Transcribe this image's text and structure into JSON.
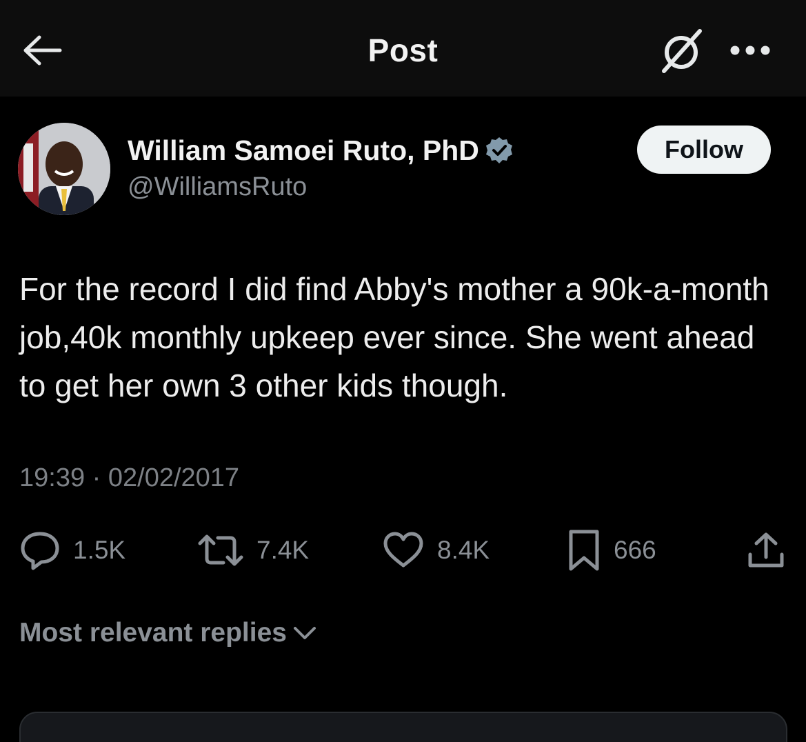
{
  "header": {
    "title": "Post",
    "back_icon": "arrow-left-icon",
    "grok_icon": "grok-slash-icon",
    "more_icon": "more-dots-icon"
  },
  "author": {
    "name": "William Samoei Ruto, PhD",
    "handle": "@WilliamsRuto",
    "verified_icon": "verified-badge-icon",
    "verified_color": "#829aab",
    "follow_label": "Follow"
  },
  "post": {
    "text": "For the record I did find Abby's mother a 90k-a-month job,40k monthly upkeep ever since. She went ahead to get her own 3 other kids though.",
    "timestamp": "19:39 · 02/02/2017"
  },
  "actions": {
    "replies": "1.5K",
    "reposts": "7.4K",
    "likes": "8.4K",
    "bookmarks": "666"
  },
  "replies_sort": {
    "label": "Most relevant replies"
  },
  "colors": {
    "background": "#000000",
    "header_background": "#0d0d0d",
    "text_primary": "#e7e9ea",
    "text_secondary": "#8b9096",
    "follow_button_bg": "#eff3f4"
  }
}
